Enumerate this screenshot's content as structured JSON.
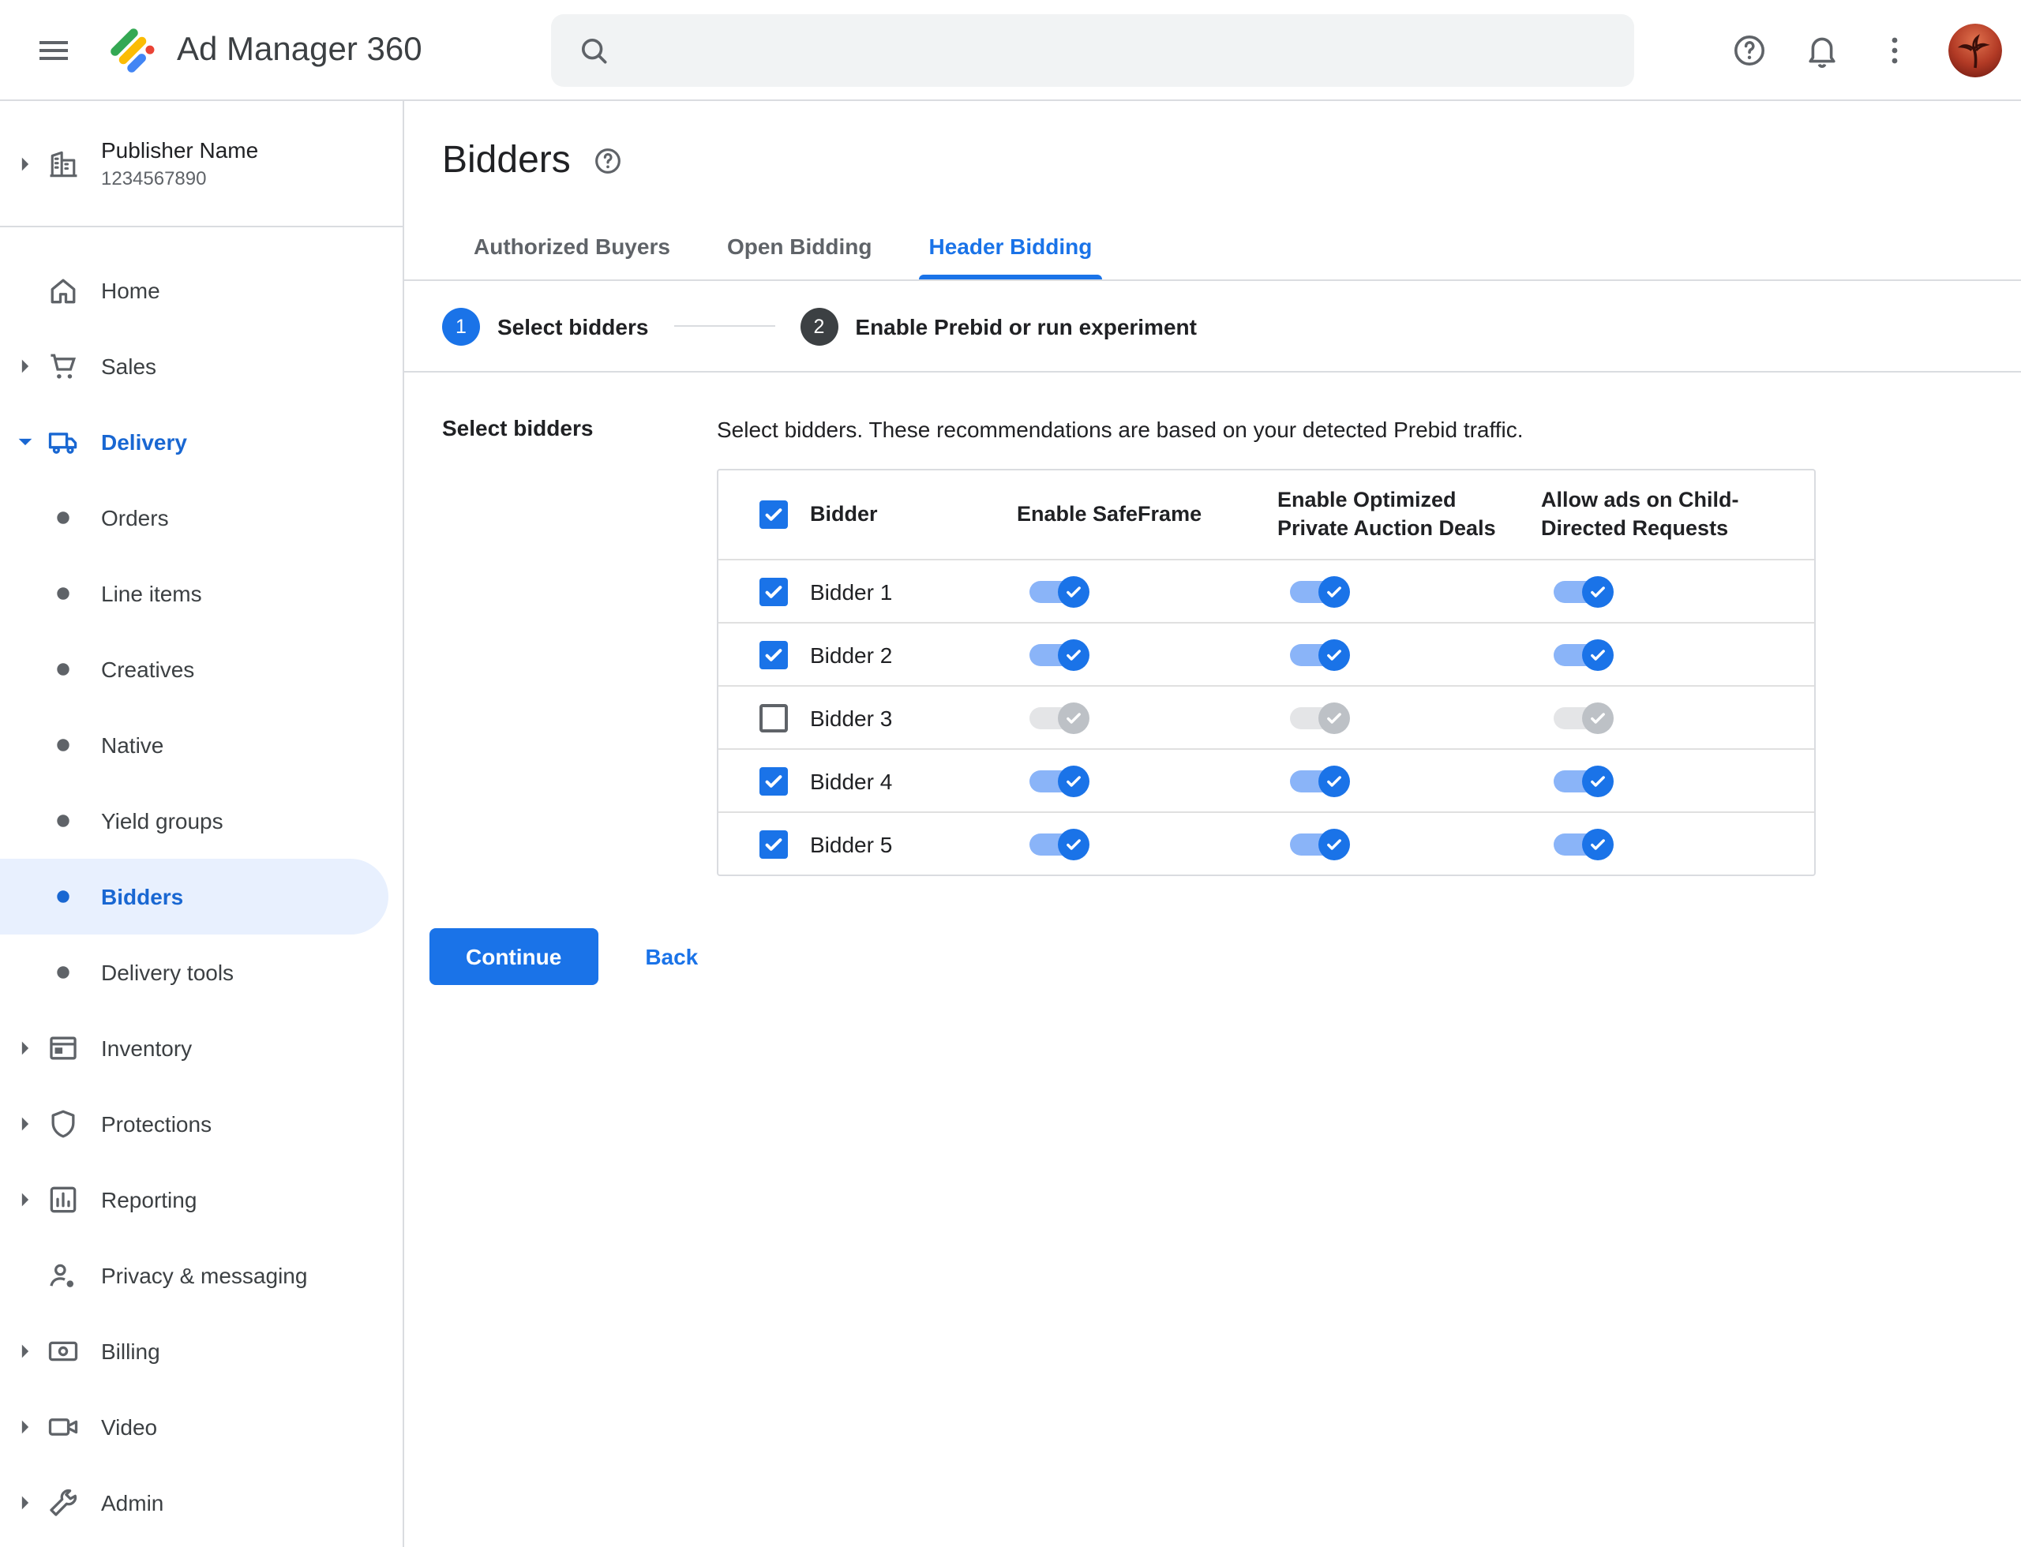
{
  "topbar": {
    "app_name": "Ad Manager 360",
    "search": {
      "placeholder": ""
    },
    "icons": [
      "menu",
      "search",
      "help",
      "notifications",
      "more-options",
      "avatar-palm-tree"
    ]
  },
  "sidebar": {
    "publisher": {
      "name": "Publisher Name",
      "id": "1234567890"
    },
    "items": [
      {
        "label": "Home",
        "icon": "home"
      },
      {
        "label": "Sales",
        "icon": "cart",
        "chevron": "right"
      },
      {
        "label": "Delivery",
        "icon": "truck",
        "chevron": "down",
        "expanded": true,
        "accent": true
      },
      {
        "label": "Orders",
        "icon": "bullet",
        "sub": true
      },
      {
        "label": "Line items",
        "icon": "bullet",
        "sub": true
      },
      {
        "label": "Creatives",
        "icon": "bullet",
        "sub": true
      },
      {
        "label": "Native",
        "icon": "bullet",
        "sub": true
      },
      {
        "label": "Yield groups",
        "icon": "bullet",
        "sub": true
      },
      {
        "label": "Bidders",
        "icon": "bullet",
        "sub": true,
        "active": true,
        "accent": true
      },
      {
        "label": "Delivery tools",
        "icon": "bullet",
        "sub": true
      },
      {
        "label": "Inventory",
        "icon": "inventory",
        "chevron": "right"
      },
      {
        "label": "Protections",
        "icon": "shield",
        "chevron": "right"
      },
      {
        "label": "Reporting",
        "icon": "chart",
        "chevron": "right"
      },
      {
        "label": "Privacy & messaging",
        "icon": "privacy"
      },
      {
        "label": "Billing",
        "icon": "billing",
        "chevron": "right"
      },
      {
        "label": "Video",
        "icon": "video",
        "chevron": "right"
      },
      {
        "label": "Admin",
        "icon": "admin",
        "chevron": "right"
      }
    ]
  },
  "page": {
    "title": "Bidders",
    "tabs": [
      {
        "label": "Authorized Buyers",
        "active": false
      },
      {
        "label": "Open Bidding",
        "active": false
      },
      {
        "label": "Header Bidding",
        "active": true
      }
    ],
    "steps": [
      {
        "number": "1",
        "label": "Select bidders",
        "state": "active"
      },
      {
        "number": "2",
        "label": "Enable Prebid or run experiment",
        "state": "upcoming"
      }
    ],
    "section_label": "Select bidders",
    "description": "Select bidders. These recommendations are based on your detected Prebid traffic.",
    "table": {
      "header": {
        "select_all_checked": true,
        "columns": [
          "Bidder",
          "Enable SafeFrame",
          "Enable Optimized Private Auction Deals",
          "Allow ads on Child-Directed Requests"
        ]
      },
      "rows": [
        {
          "name": "Bidder 1",
          "checked": true,
          "safeframe": true,
          "optimized": true,
          "child_directed": true
        },
        {
          "name": "Bidder 2",
          "checked": true,
          "safeframe": true,
          "optimized": true,
          "child_directed": true
        },
        {
          "name": "Bidder 3",
          "checked": false,
          "safeframe": false,
          "optimized": false,
          "child_directed": false
        },
        {
          "name": "Bidder 4",
          "checked": true,
          "safeframe": true,
          "optimized": true,
          "child_directed": true
        },
        {
          "name": "Bidder 5",
          "checked": true,
          "safeframe": true,
          "optimized": true,
          "child_directed": true
        }
      ]
    },
    "actions": {
      "continue_label": "Continue",
      "back_label": "Back"
    }
  },
  "colors": {
    "accent": "#1a73e8",
    "active_nav_text": "#1967d2",
    "active_nav_bg": "#e8f0fe",
    "toggle_on_track": "#8ab4f8",
    "toggle_on_thumb": "#1a73e8",
    "toggle_off_track": "#e4e5e7",
    "toggle_off_thumb": "#bdc1c6",
    "brand": [
      "#4285f4",
      "#34a853",
      "#fbbc04",
      "#ea4335"
    ]
  }
}
